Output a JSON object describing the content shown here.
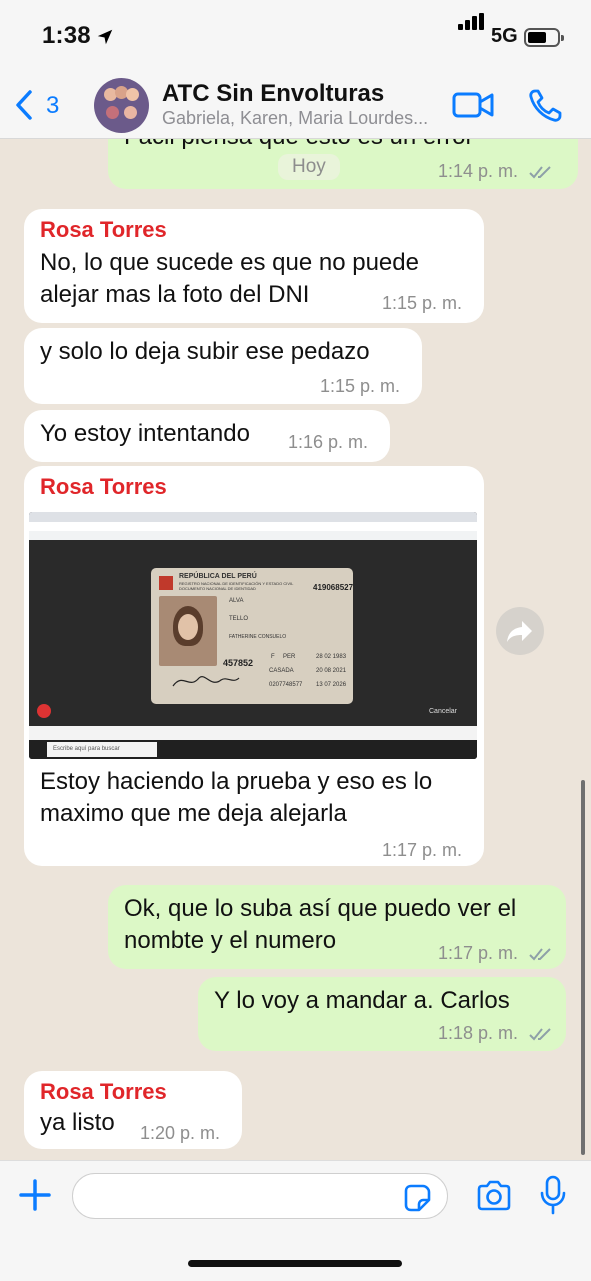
{
  "status": {
    "time": "1:38",
    "network": "5G"
  },
  "header": {
    "back_count": "3",
    "title": "ATC Sin Envolturas",
    "subtitle": "Gabriela, Karen, Maria Lourdes..."
  },
  "date_chip": "Hoy",
  "messages": [
    {
      "dir": "out",
      "text": "Facil piensa que esto es un error",
      "time": "1:14 p. m."
    },
    {
      "dir": "in",
      "sender": "Rosa Torres",
      "text_lines": [
        "No, lo que sucede es que no puede",
        "alejar mas la foto del DNI"
      ],
      "time": "1:15 p. m."
    },
    {
      "dir": "in",
      "text": "y solo lo deja subir ese pedazo",
      "time": "1:15 p. m."
    },
    {
      "dir": "in",
      "text": "Yo estoy intentando",
      "time": "1:16 p. m."
    },
    {
      "dir": "in",
      "sender": "Rosa Torres",
      "type": "image",
      "text_lines": [
        "Estoy haciendo la prueba y eso es lo",
        "maximo que me deja alejarla"
      ],
      "time": "1:17 p. m."
    },
    {
      "dir": "out",
      "text_lines": [
        "Ok, que lo suba así que puedo ver el",
        "nombte y el numero"
      ],
      "time": "1:17 p. m."
    },
    {
      "dir": "out",
      "text": "Y lo voy a mandar a. Carlos",
      "time": "1:18 p. m."
    },
    {
      "dir": "in",
      "sender": "Rosa Torres",
      "text": "ya listo",
      "time": "1:20 p. m."
    }
  ],
  "screenshot_image": {
    "card_lines": [
      "REPÚBLICA DEL PERÚ",
      "REGISTRO NACIONAL DE IDENTIFICACIÓN Y ESTADO CIVIL",
      "DOCUMENTO NACIONAL DE IDENTIDAD",
      "419068527",
      "ALVA",
      "TELLO",
      "FATHERINE CONSUELO",
      "457852",
      "F",
      "PER",
      "28 02 1983",
      "CASADA",
      "20 08 2021",
      "0207748577",
      "13 07 2026"
    ],
    "cancel_label": "Cancelar",
    "search_placeholder": "Escribe aquí para buscar"
  },
  "colors": {
    "accent": "#0b7cff",
    "sender": "#e0262a",
    "outgoing": "#dcf8c6",
    "incoming": "#ffffff",
    "ticks": "#8ea0a8"
  },
  "icons": [
    "location-arrow-icon",
    "signal-icon",
    "battery-icon",
    "back-chevron-icon",
    "video-call-icon",
    "phone-call-icon",
    "read-ticks-icon",
    "forward-icon",
    "plus-icon",
    "sticker-icon",
    "camera-icon",
    "microphone-icon"
  ]
}
